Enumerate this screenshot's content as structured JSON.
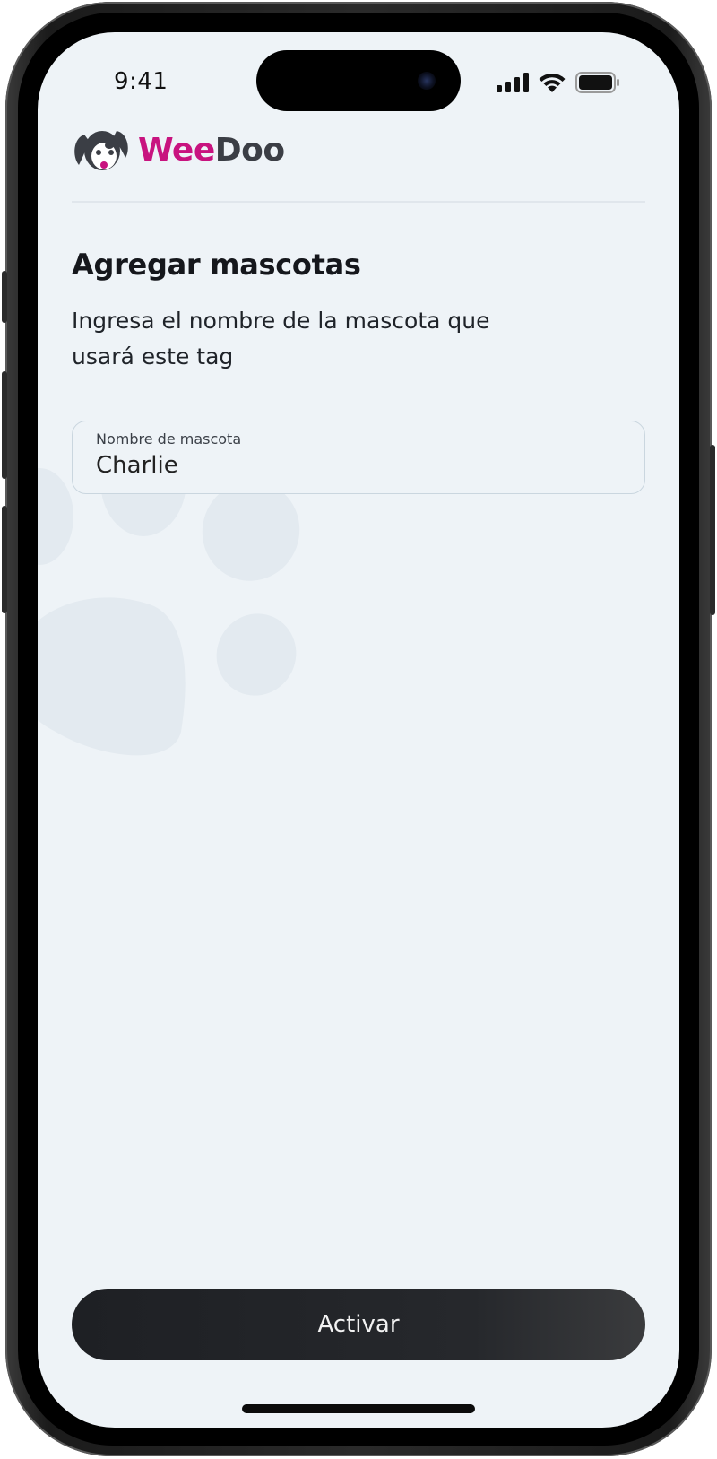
{
  "status_bar": {
    "time": "9:41",
    "icons": [
      "cellular-signal-icon",
      "wifi-icon",
      "battery-icon"
    ]
  },
  "header": {
    "brand_part1": "Wee",
    "brand_part2": "Doo",
    "logo_icon": "dog-head-icon"
  },
  "main": {
    "title": "Agregar mascotas",
    "description": "Ingresa el nombre de la mascota que usará este tag",
    "pet_name_field": {
      "label": "Nombre de mascota",
      "value": "Charlie"
    },
    "background_icon": "paw-print-icon"
  },
  "footer": {
    "activate_label": "Activar"
  },
  "colors": {
    "brand_magenta": "#c8137f",
    "brand_dark": "#3b3e45",
    "screen_bg": "#eef3f7",
    "button_bg": "#1e2024"
  }
}
